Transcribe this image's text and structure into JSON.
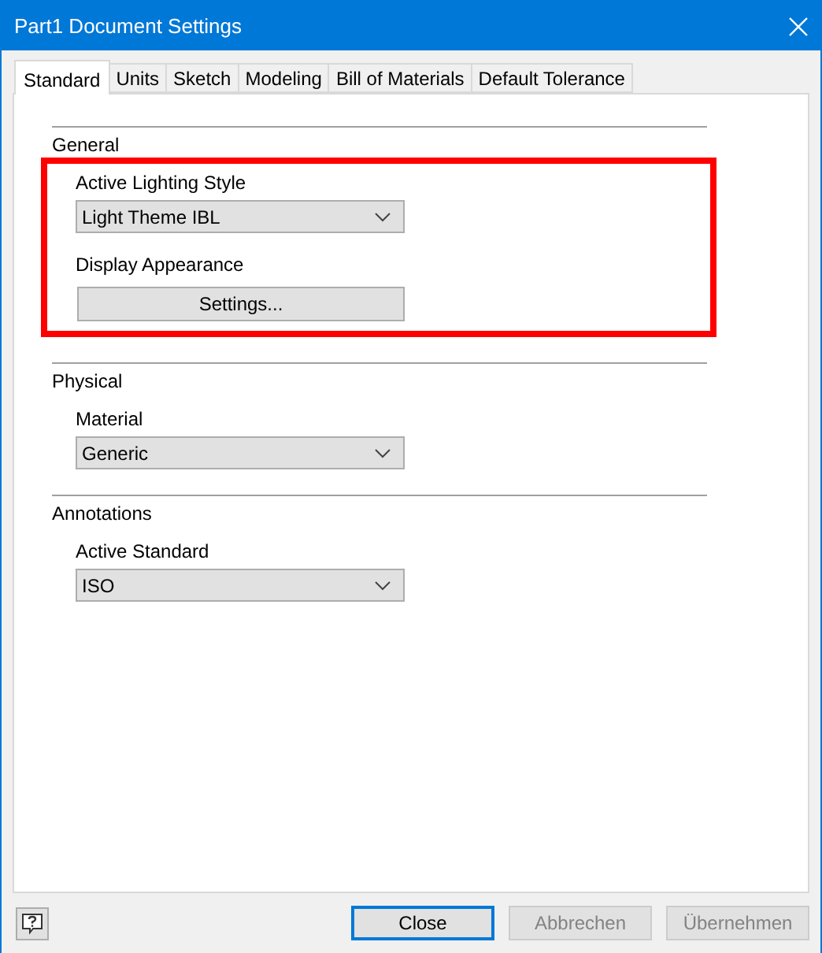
{
  "window": {
    "title": "Part1 Document Settings"
  },
  "tabs": [
    {
      "label": "Standard",
      "selected": true
    },
    {
      "label": "Units",
      "selected": false
    },
    {
      "label": "Sketch",
      "selected": false
    },
    {
      "label": "Modeling",
      "selected": false
    },
    {
      "label": "Bill of Materials",
      "selected": false
    },
    {
      "label": "Default Tolerance",
      "selected": false
    }
  ],
  "sections": [
    {
      "title": "General",
      "highlighted": true,
      "fields": [
        {
          "kind": "dropdown",
          "label": "Active Lighting Style",
          "value": "Light Theme IBL"
        },
        {
          "kind": "button",
          "label": "Display Appearance",
          "button": "Settings..."
        }
      ]
    },
    {
      "title": "Physical",
      "highlighted": false,
      "fields": [
        {
          "kind": "dropdown",
          "label": "Material",
          "value": "Generic"
        }
      ]
    },
    {
      "title": "Annotations",
      "highlighted": false,
      "fields": [
        {
          "kind": "dropdown",
          "label": "Active Standard",
          "value": "ISO"
        }
      ]
    }
  ],
  "buttons": [
    {
      "label": "Close",
      "default": true,
      "disabled": false
    },
    {
      "label": "Abbrechen",
      "default": false,
      "disabled": true
    },
    {
      "label": "Übernehmen",
      "default": false,
      "disabled": true
    }
  ]
}
